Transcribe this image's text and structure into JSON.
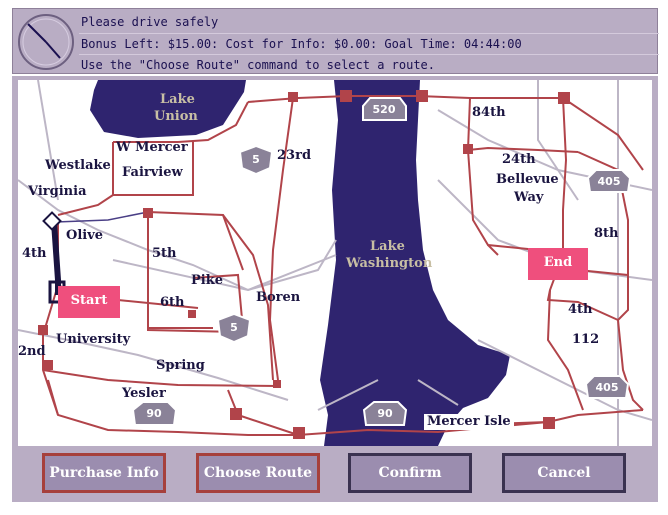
{
  "status": {
    "line1": "Please drive safely",
    "line2": "Bonus Left: $15.00: Cost for Info: $0.00: Goal Time: 04:44:00",
    "line3": "Use the \"Choose Route\" command to select a route."
  },
  "map": {
    "water": {
      "lake_union": [
        "Lake",
        "Union"
      ],
      "lake_washington": [
        "Lake",
        "Washington"
      ]
    },
    "streets": {
      "w_mercer": "W Mercer",
      "fairview": "Fairview",
      "westlake": "Westlake",
      "virginia": "Virginia",
      "olive": "Olive",
      "fourth_west": "4th",
      "fifth": "5th",
      "pike": "Pike",
      "sixth": "6th",
      "boren": "Boren",
      "second": "2nd",
      "university": "University",
      "spring": "Spring",
      "yesler": "Yesler",
      "twenty_third": "23rd",
      "eighty_fourth": "84th",
      "twenty_fourth": "24th",
      "bellevue_way": [
        "Bellevue",
        "Way"
      ],
      "eighth": "8th",
      "fourth_east": "4th",
      "one_twelve": "112",
      "mercer_isle": "Mercer Isle"
    },
    "shields": {
      "i520": "520",
      "i5_north": "5",
      "i5_south": "5",
      "i90_west": "90",
      "i90_mid": "90",
      "i405_north": "405",
      "i405_south": "405"
    },
    "markers": {
      "start": "Start",
      "end": "End"
    }
  },
  "buttons": {
    "purchase_info": "Purchase Info",
    "choose_route": "Choose Route",
    "confirm": "Confirm",
    "cancel": "Cancel"
  },
  "colors": {
    "panel": "#b9adc4",
    "water": "#2f246f",
    "road": "#b1444a",
    "highway_shield": "#8a8298",
    "marker": "#ef4f7d",
    "button_active_border": "#a6403c",
    "button_border": "#3a3250"
  }
}
